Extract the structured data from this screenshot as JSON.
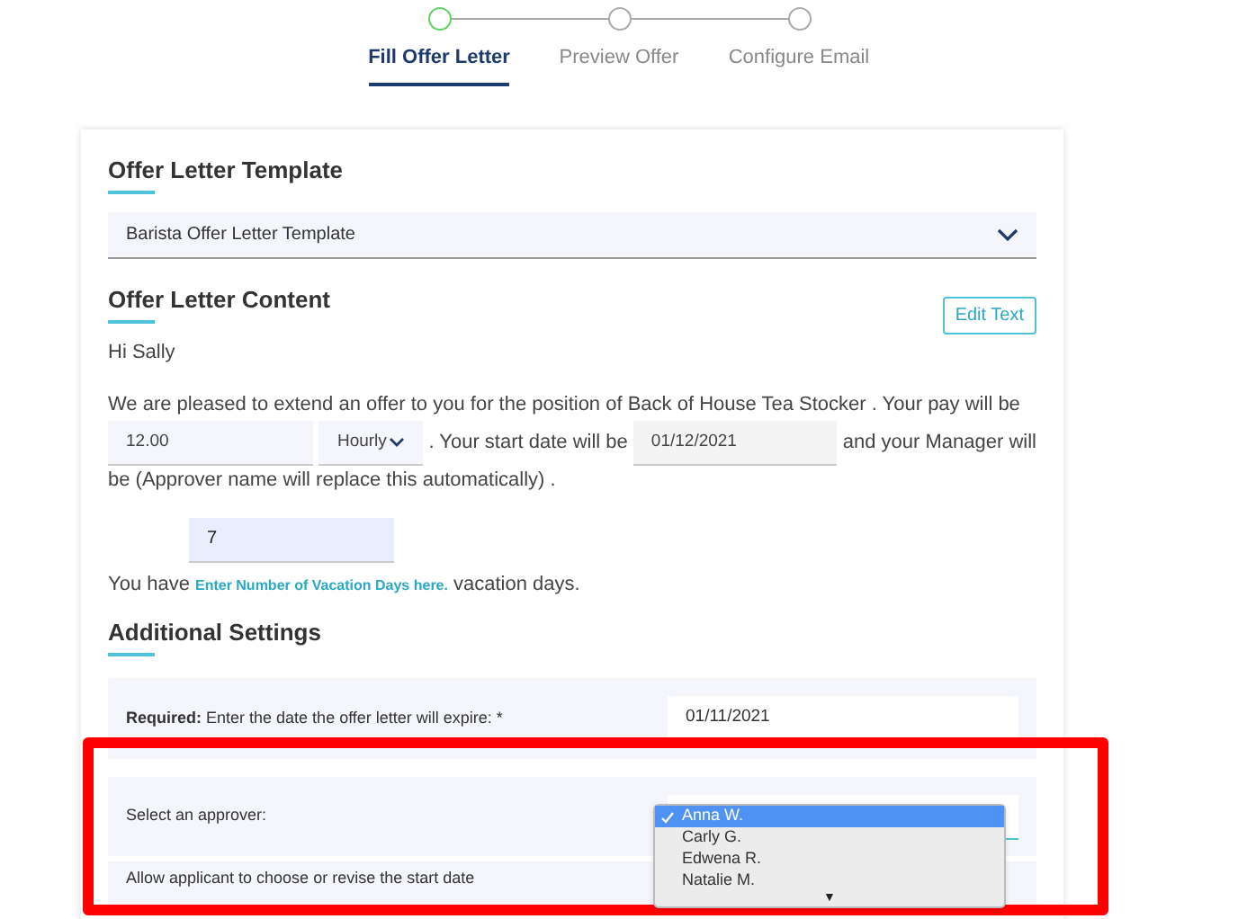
{
  "steps": [
    {
      "label": "Fill Offer Letter",
      "selected": true
    },
    {
      "label": "Preview Offer",
      "selected": false
    },
    {
      "label": "Configure Email",
      "selected": false
    }
  ],
  "template_section": {
    "title": "Offer Letter Template",
    "value": "Barista Offer Letter Template"
  },
  "content_section": {
    "title": "Offer Letter Content",
    "edit_button": "Edit Text",
    "greeting": "Hi Sally",
    "sentence_1": "We are pleased to extend an offer to you for the position of Back of House Tea Stocker . Your pay will be",
    "pay_field": "12.00",
    "pay_period": "Hourly",
    "sentence_2": ". Your start date will be",
    "start_date": "01/12/2021",
    "sentence_3": "and your Manager will",
    "sentence_4": "be (Approver name will replace this automatically) .",
    "vacation_field": "7",
    "vacation_prefix": "You have",
    "vacation_link": "Enter Number of Vacation Days here.",
    "vacation_suffix": "vacation days."
  },
  "additional_settings": {
    "title": "Additional Settings",
    "expiry": {
      "label": "**Required:** Enter the date the offer letter will expire: *",
      "value": "01/11/2021"
    },
    "approver": {
      "label": "Select an approver:",
      "options": [
        {
          "label": "Anna W.",
          "selected": true
        },
        {
          "label": "Carly G.",
          "selected": false
        },
        {
          "label": "Edwena R.",
          "selected": false
        },
        {
          "label": "Natalie M.",
          "selected": false
        }
      ],
      "more": "▼"
    },
    "start_date_row": {
      "label": "Allow applicant to choose or revise the start date"
    }
  }
}
